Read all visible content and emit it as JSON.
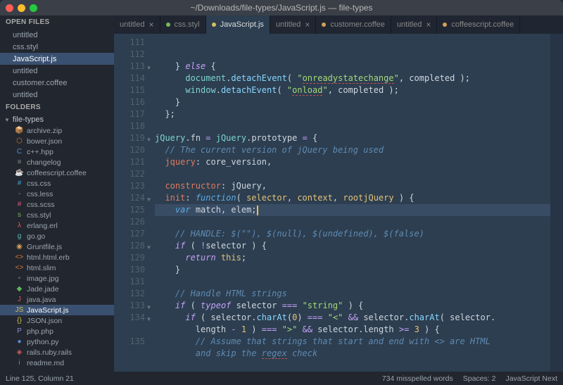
{
  "window": {
    "title": "~/Downloads/file-types/JavaScript.js — file-types"
  },
  "sidebar": {
    "open_files_header": "OPEN FILES",
    "open_files": [
      {
        "name": "untitled",
        "active": false
      },
      {
        "name": "css.styl",
        "active": false
      },
      {
        "name": "JavaScript.js",
        "active": true
      },
      {
        "name": "untitled",
        "active": false
      },
      {
        "name": "customer.coffee",
        "active": false
      },
      {
        "name": "untitled",
        "active": false
      }
    ],
    "folders_header": "FOLDERS",
    "folder_name": "file-types",
    "tree": [
      {
        "name": "archive.zip",
        "icon": "📦",
        "color": "#8a8a8a"
      },
      {
        "name": "bower.json",
        "icon": "⬡",
        "color": "#d07a3a"
      },
      {
        "name": "c++.hpp",
        "icon": "C",
        "color": "#5a8dd6"
      },
      {
        "name": "changelog",
        "icon": "≡",
        "color": "#888"
      },
      {
        "name": "coffeescript.coffee",
        "icon": "☕",
        "color": "#d4a05a"
      },
      {
        "name": "css.css",
        "icon": "#",
        "color": "#4aa0d8"
      },
      {
        "name": "css.less",
        "icon": "-",
        "color": "#4aa0d8"
      },
      {
        "name": "css.scss",
        "icon": "#",
        "color": "#d85a8a"
      },
      {
        "name": "css.styl",
        "icon": "s",
        "color": "#7ab85a"
      },
      {
        "name": "erlang.erl",
        "icon": "λ",
        "color": "#d85a5a"
      },
      {
        "name": "go.go",
        "icon": "g",
        "color": "#5ab8b8"
      },
      {
        "name": "Gruntfile.js",
        "icon": "◉",
        "color": "#d4a05a"
      },
      {
        "name": "html.html.erb",
        "icon": "<>",
        "color": "#d07a3a"
      },
      {
        "name": "html.slim",
        "icon": "<>",
        "color": "#d07a3a"
      },
      {
        "name": "image.jpg",
        "icon": "▫",
        "color": "#b090d0"
      },
      {
        "name": "Jade.jade",
        "icon": "◆",
        "color": "#5ab85a"
      },
      {
        "name": "java.java",
        "icon": "J",
        "color": "#d85a5a"
      },
      {
        "name": "JavaScript.js",
        "icon": "JS",
        "color": "#d4c05a",
        "active": true
      },
      {
        "name": "JSON.json",
        "icon": "{}",
        "color": "#d4c05a"
      },
      {
        "name": "php.php",
        "icon": "P",
        "color": "#8a8ad4"
      },
      {
        "name": "python.py",
        "icon": "●",
        "color": "#5a8dd6"
      },
      {
        "name": "rails.ruby.rails",
        "icon": "◈",
        "color": "#d85a5a"
      },
      {
        "name": "readme.md",
        "icon": "i",
        "color": "#5a8dd6"
      }
    ]
  },
  "tabs": [
    {
      "label": "untitled",
      "indicator": "close",
      "active": false
    },
    {
      "label": "css.styl",
      "indicator": "dot",
      "color": "#7ab85a",
      "active": false
    },
    {
      "label": "JavaScript.js",
      "indicator": "dot",
      "color": "#d4c05a",
      "active": true
    },
    {
      "label": "untitled",
      "indicator": "close",
      "active": false
    },
    {
      "label": "customer.coffee",
      "indicator": "dot",
      "color": "#d4a05a",
      "active": false
    },
    {
      "label": "untitled",
      "indicator": "close",
      "active": false
    },
    {
      "label": "coffeescript.coffee",
      "indicator": "dot",
      "color": "#d4a05a",
      "active": false
    }
  ],
  "code": {
    "first_line": 111,
    "highlight_line": 125,
    "folds": [
      113,
      119,
      124,
      128,
      133,
      134
    ],
    "lines": [
      {
        "n": 111,
        "tokens": []
      },
      {
        "n": 112,
        "tokens": []
      },
      {
        "n": 113,
        "tokens": [
          {
            "t": "    } ",
            "c": "p"
          },
          {
            "t": "else",
            "c": "k"
          },
          {
            "t": " {",
            "c": "p"
          }
        ]
      },
      {
        "n": 114,
        "tokens": [
          {
            "t": "      ",
            "c": "p"
          },
          {
            "t": "document",
            "c": "o"
          },
          {
            "t": ".",
            "c": "p"
          },
          {
            "t": "detachEvent",
            "c": "fnm"
          },
          {
            "t": "( ",
            "c": "p"
          },
          {
            "t": "\"",
            "c": "s"
          },
          {
            "t": "onreadystatechange",
            "c": "s sp-err"
          },
          {
            "t": "\"",
            "c": "s"
          },
          {
            "t": ", completed );",
            "c": "p"
          }
        ]
      },
      {
        "n": 115,
        "tokens": [
          {
            "t": "      ",
            "c": "p"
          },
          {
            "t": "window",
            "c": "o"
          },
          {
            "t": ".",
            "c": "p"
          },
          {
            "t": "detachEvent",
            "c": "fnm"
          },
          {
            "t": "( ",
            "c": "p"
          },
          {
            "t": "\"",
            "c": "s"
          },
          {
            "t": "onload",
            "c": "s sp-err"
          },
          {
            "t": "\"",
            "c": "s"
          },
          {
            "t": ", completed );",
            "c": "p"
          }
        ]
      },
      {
        "n": 116,
        "tokens": [
          {
            "t": "    }",
            "c": "p"
          }
        ]
      },
      {
        "n": 117,
        "tokens": [
          {
            "t": "  };",
            "c": "p"
          }
        ]
      },
      {
        "n": 118,
        "tokens": []
      },
      {
        "n": 119,
        "tokens": [
          {
            "t": "jQuery",
            "c": "o"
          },
          {
            "t": ".",
            "c": "p"
          },
          {
            "t": "fn",
            "c": "v"
          },
          {
            "t": " = ",
            "c": "op"
          },
          {
            "t": "jQuery",
            "c": "o"
          },
          {
            "t": ".",
            "c": "p"
          },
          {
            "t": "prototype",
            "c": "v"
          },
          {
            "t": " = ",
            "c": "op"
          },
          {
            "t": "{",
            "c": "p"
          }
        ]
      },
      {
        "n": 120,
        "tokens": [
          {
            "t": "  // The current version of jQuery being used",
            "c": "c"
          }
        ]
      },
      {
        "n": 121,
        "tokens": [
          {
            "t": "  ",
            "c": "p"
          },
          {
            "t": "jquery",
            "c": "prop"
          },
          {
            "t": ": core_version,",
            "c": "p"
          }
        ]
      },
      {
        "n": 122,
        "tokens": []
      },
      {
        "n": 123,
        "tokens": [
          {
            "t": "  ",
            "c": "p"
          },
          {
            "t": "constructor",
            "c": "prop"
          },
          {
            "t": ": jQuery,",
            "c": "p"
          }
        ]
      },
      {
        "n": 124,
        "tokens": [
          {
            "t": "  ",
            "c": "p"
          },
          {
            "t": "init",
            "c": "prop"
          },
          {
            "t": ": ",
            "c": "p"
          },
          {
            "t": "function",
            "c": "kw-var"
          },
          {
            "t": "( ",
            "c": "p"
          },
          {
            "t": "selector",
            "c": "n"
          },
          {
            "t": ", ",
            "c": "p"
          },
          {
            "t": "context",
            "c": "n"
          },
          {
            "t": ", ",
            "c": "p"
          },
          {
            "t": "rootjQuery",
            "c": "n"
          },
          {
            "t": " ) {",
            "c": "p"
          }
        ]
      },
      {
        "n": 125,
        "tokens": [
          {
            "t": "    ",
            "c": "p"
          },
          {
            "t": "var",
            "c": "kw-var"
          },
          {
            "t": " match, elem;",
            "c": "p"
          }
        ],
        "cursor": true
      },
      {
        "n": 126,
        "tokens": []
      },
      {
        "n": 127,
        "tokens": [
          {
            "t": "    // HANDLE: $(\"\"), $(null), $(undefined), $(false)",
            "c": "c"
          }
        ]
      },
      {
        "n": 128,
        "tokens": [
          {
            "t": "    ",
            "c": "p"
          },
          {
            "t": "if",
            "c": "k"
          },
          {
            "t": " ( ",
            "c": "p"
          },
          {
            "t": "!",
            "c": "op"
          },
          {
            "t": "selector ) {",
            "c": "p"
          }
        ]
      },
      {
        "n": 129,
        "tokens": [
          {
            "t": "      ",
            "c": "p"
          },
          {
            "t": "return",
            "c": "k"
          },
          {
            "t": " ",
            "c": "p"
          },
          {
            "t": "this",
            "c": "n"
          },
          {
            "t": ";",
            "c": "p"
          }
        ]
      },
      {
        "n": 130,
        "tokens": [
          {
            "t": "    }",
            "c": "p"
          }
        ]
      },
      {
        "n": 131,
        "tokens": []
      },
      {
        "n": 132,
        "tokens": [
          {
            "t": "    // Handle HTML strings",
            "c": "c"
          }
        ]
      },
      {
        "n": 133,
        "tokens": [
          {
            "t": "    ",
            "c": "p"
          },
          {
            "t": "if",
            "c": "k"
          },
          {
            "t": " ( ",
            "c": "p"
          },
          {
            "t": "typeof",
            "c": "k"
          },
          {
            "t": " selector ",
            "c": "p"
          },
          {
            "t": "===",
            "c": "op"
          },
          {
            "t": " ",
            "c": "p"
          },
          {
            "t": "\"string\"",
            "c": "s"
          },
          {
            "t": " ) {",
            "c": "p"
          }
        ]
      },
      {
        "n": 134,
        "tokens": [
          {
            "t": "      ",
            "c": "p"
          },
          {
            "t": "if",
            "c": "k"
          },
          {
            "t": " ( selector.",
            "c": "p"
          },
          {
            "t": "charAt",
            "c": "fnm"
          },
          {
            "t": "(",
            "c": "p"
          },
          {
            "t": "0",
            "c": "n"
          },
          {
            "t": ") ",
            "c": "p"
          },
          {
            "t": "===",
            "c": "op"
          },
          {
            "t": " ",
            "c": "p"
          },
          {
            "t": "\"<\"",
            "c": "s"
          },
          {
            "t": " ",
            "c": "p"
          },
          {
            "t": "&&",
            "c": "op"
          },
          {
            "t": " selector.",
            "c": "p"
          },
          {
            "t": "charAt",
            "c": "fnm"
          },
          {
            "t": "( selector.",
            "c": "p"
          }
        ]
      },
      {
        "n": "",
        "tokens": [
          {
            "t": "        length ",
            "c": "p"
          },
          {
            "t": "-",
            "c": "op"
          },
          {
            "t": " ",
            "c": "p"
          },
          {
            "t": "1",
            "c": "n"
          },
          {
            "t": " ) ",
            "c": "p"
          },
          {
            "t": "===",
            "c": "op"
          },
          {
            "t": " ",
            "c": "p"
          },
          {
            "t": "\">\"",
            "c": "s"
          },
          {
            "t": " ",
            "c": "p"
          },
          {
            "t": "&&",
            "c": "op"
          },
          {
            "t": " selector.length ",
            "c": "p"
          },
          {
            "t": ">=",
            "c": "op"
          },
          {
            "t": " ",
            "c": "p"
          },
          {
            "t": "3",
            "c": "n"
          },
          {
            "t": " ) {",
            "c": "p"
          }
        ]
      },
      {
        "n": 135,
        "tokens": [
          {
            "t": "        // Assume that strings that start and end with <> are HTML",
            "c": "c"
          }
        ]
      },
      {
        "n": "",
        "tokens": [
          {
            "t": "        and skip the ",
            "c": "c"
          },
          {
            "t": "regex",
            "c": "c sp-err"
          },
          {
            "t": " check",
            "c": "c"
          }
        ]
      }
    ]
  },
  "statusbar": {
    "left": "Line 125, Column 21",
    "words": "734 misspelled words",
    "spaces": "Spaces: 2",
    "lang": "JavaScript Next"
  }
}
